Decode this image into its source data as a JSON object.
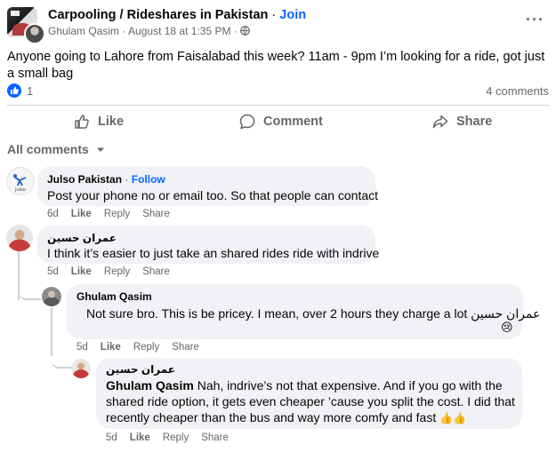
{
  "post": {
    "group_name": "Carpooling / Rideshares in Pakistan",
    "separator": "·",
    "join_label": "Join",
    "author": "Ghulam Qasim",
    "timestamp": "August 18 at 1:35 PM",
    "text": "Anyone going to Lahore from Faisalabad this week? 11am - 9pm I’m looking for a ride, got just a small bag",
    "reaction_count": "1",
    "comments_count": "4 comments"
  },
  "actions": {
    "like": "Like",
    "comment": "Comment",
    "share": "Share"
  },
  "filter": {
    "label": "All comments"
  },
  "comments": [
    {
      "author": "Julso Pakistan",
      "follow": "Follow",
      "text": "Post your phone no or email too. So that people can contact",
      "age": "6d",
      "like": "Like",
      "reply": "Reply",
      "share": "Share"
    },
    {
      "author": "عمران حسين",
      "text": "I think it’s easier to just take an shared rides ride with indrive",
      "age": "5d",
      "like": "Like",
      "reply": "Reply",
      "share": "Share"
    },
    {
      "author": "Ghulam Qasim",
      "text": "Not sure bro. This is be pricey. I mean, over 2 hours they charge a lot",
      "mention": "عمران حسين",
      "emoji": "😢",
      "age": "5d",
      "like": "Like",
      "reply": "Reply",
      "share": "Share"
    },
    {
      "author": "عمران حسين",
      "mention": "Ghulam Qasim",
      "text_line1": "Nah, indrive’s not that expensive. And if you go with the",
      "text_line2": "shared ride option, it gets even cheaper ’cause you split the cost. I did that",
      "text_line3": "recently cheaper than the bus and way more comfy and fast",
      "emoji": "👍👍",
      "age": "5d",
      "like": "Like",
      "reply": "Reply",
      "share": "Share"
    }
  ],
  "colors": {
    "accent": "#0866ff",
    "muted": "#65676b",
    "bubble": "#f0f2f5"
  }
}
